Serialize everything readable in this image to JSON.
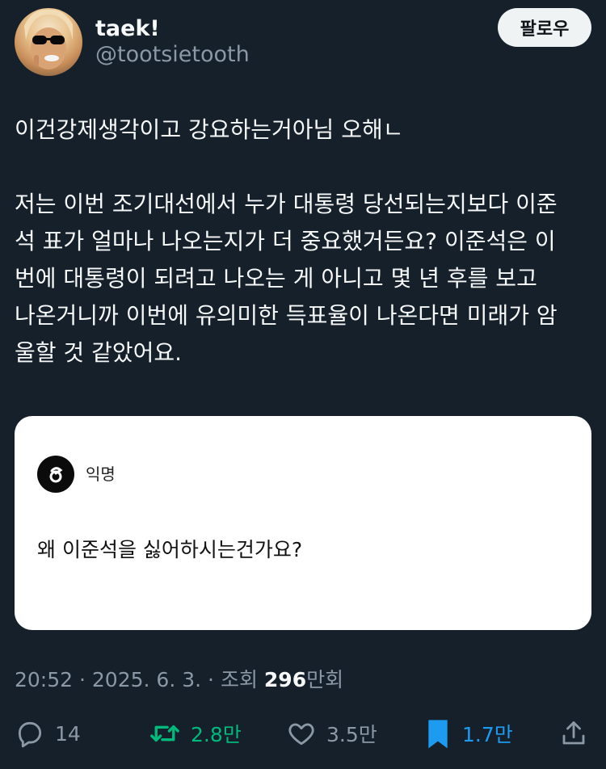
{
  "author": {
    "name": "taek!",
    "handle": "@tootsietooth",
    "follow_label": "팔로우"
  },
  "tweet": {
    "line1": "이건강제생각이고 강요하는거아님 오해ㄴ",
    "para2": [
      "저는 이번 조기대선에서 누가 대통령 당선되는지보다 이준",
      "석 표가 얼마나 나오는지가 더 중요했거든요? 이준석은 이",
      "번에 대통령이 되려고 나오는 게 아니고 몇 년 후를 보고",
      "나온거니까 이번에 유의미한 득표율이 나온다면 미래가 암",
      "울할 것 같았어요."
    ]
  },
  "card": {
    "anon_label": "익명",
    "question": "왜 이준석을 싫어하시는건가요?"
  },
  "meta": {
    "time": "20:52",
    "date": "2025. 6. 3.",
    "views_prefix": "조회",
    "views_number": "296",
    "views_suffix": "만회"
  },
  "actions": {
    "replies": "14",
    "retweets": "2.8만",
    "likes": "3.5만",
    "bookmarks": "1.7만"
  },
  "colors": {
    "background": "#15202b",
    "retweet_green": "#00ba7c",
    "bookmark_blue": "#1d9bf0",
    "secondary_text": "#8b98a5"
  },
  "icons": [
    "reply-icon",
    "retweet-icon",
    "like-icon",
    "bookmark-icon",
    "share-icon",
    "anonymous-logo-icon"
  ]
}
